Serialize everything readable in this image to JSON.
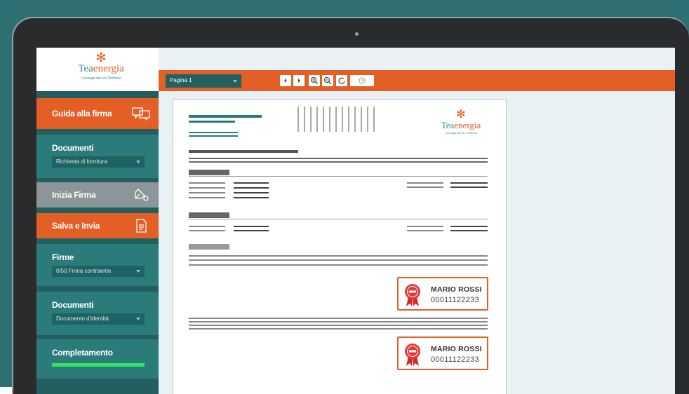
{
  "brand": {
    "flower": "✻",
    "name_part1": "Tea",
    "name_part2": "energia",
    "tagline": "L'energia del tuo Territorio"
  },
  "sidebar": {
    "guide_label": "Guida alla firma",
    "documents_title": "Documenti",
    "documents_select": "Richiesta di fornitura",
    "start_sign_label": "Inizia Firma",
    "save_send_label": "Salva e Invia",
    "signatures_title": "Firme",
    "signatures_select": "0/50 Firma contraente",
    "documents2_title": "Documenti",
    "documents2_select": "Documento d'identità",
    "completion_title": "Completamento",
    "completion_progress": 1.0
  },
  "toolbar": {
    "page_select": "Pagina 1",
    "icons": [
      "prev-page-icon",
      "next-page-icon",
      "zoom-in-icon",
      "zoom-out-icon",
      "rotate-icon",
      "history-icon"
    ]
  },
  "document": {
    "signatures": [
      {
        "name": "MARIO ROSSI",
        "code": "00011122233"
      },
      {
        "name": "MARIO ROSSI",
        "code": "00011122233"
      }
    ]
  },
  "colors": {
    "accent": "#e35f25",
    "teal": "#2b7b7b",
    "progress": "#2ee65a"
  }
}
